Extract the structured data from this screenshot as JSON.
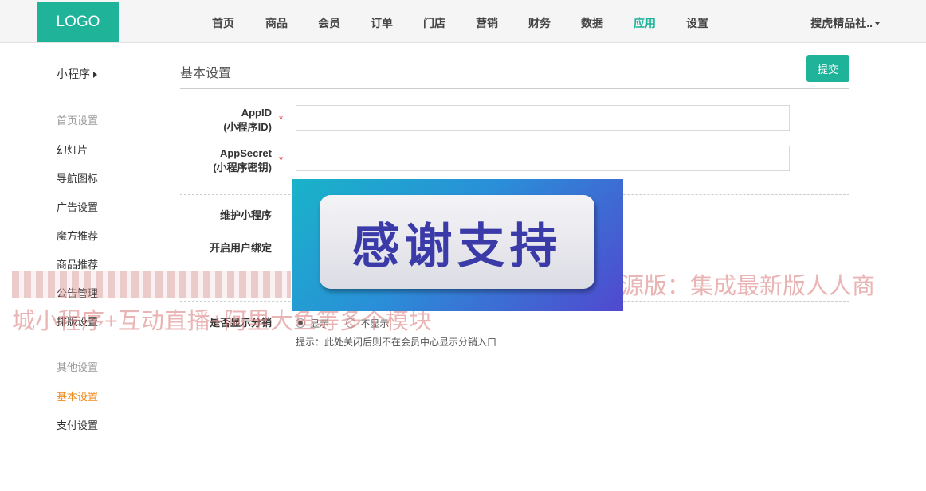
{
  "header": {
    "logo": "LOGO",
    "nav": [
      {
        "label": "首页",
        "active": false
      },
      {
        "label": "商品",
        "active": false
      },
      {
        "label": "会员",
        "active": false
      },
      {
        "label": "订单",
        "active": false
      },
      {
        "label": "门店",
        "active": false
      },
      {
        "label": "营销",
        "active": false
      },
      {
        "label": "财务",
        "active": false
      },
      {
        "label": "数据",
        "active": false
      },
      {
        "label": "应用",
        "active": true
      },
      {
        "label": "设置",
        "active": false
      }
    ],
    "user": "搜虎精品社.."
  },
  "sidebar": {
    "title": "小程序",
    "groups": [
      {
        "label": "首页设置",
        "items": [
          "幻灯片",
          "导航图标",
          "广告设置",
          "魔方推荐",
          "商品推荐",
          "公告管理",
          "排版设置"
        ]
      },
      {
        "label": "其他设置",
        "items": [
          "基本设置",
          "支付设置"
        ]
      }
    ],
    "active_item": "基本设置"
  },
  "main": {
    "section_title": "基本设置",
    "submit_label": "提交",
    "fields": [
      {
        "label_line1": "AppID",
        "label_line2": "(小程序ID)",
        "required": "*",
        "value": ""
      },
      {
        "label_line1": "AppSecret",
        "label_line2": "(小程序密钥)",
        "required": "*",
        "value": ""
      }
    ],
    "maintain_label": "维护小程序",
    "user_bind_label": "开启用户绑定",
    "distribution": {
      "label": "是否显示分销",
      "options": [
        "显示",
        "不显示"
      ],
      "selected": "显示",
      "hint": "提示：此处关闭后则不在会员中心显示分销入口"
    }
  },
  "overlay": {
    "banner_text": "感谢支持",
    "watermark_line1": "源版：集成最新版人人商",
    "watermark_line2": "城小程序+互动直播+阿里大鱼等多个模块"
  },
  "colors": {
    "brand": "#1fb39a",
    "active_sidebar": "#f08a1c",
    "required": "#e33333"
  }
}
